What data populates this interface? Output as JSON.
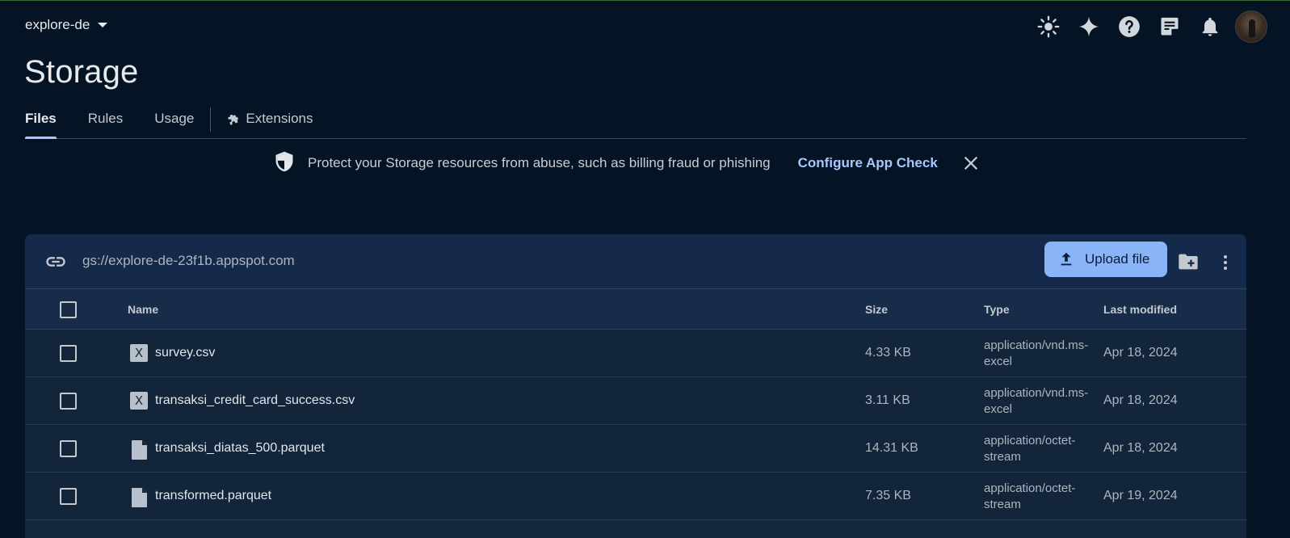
{
  "project": {
    "name": "explore-de"
  },
  "header_icons": [
    "brightness-icon",
    "sparkle-icon",
    "help-icon",
    "notes-icon",
    "bell-icon"
  ],
  "page": {
    "title": "Storage"
  },
  "tabs": [
    {
      "label": "Files",
      "active": true
    },
    {
      "label": "Rules",
      "active": false
    },
    {
      "label": "Usage",
      "active": false
    },
    {
      "label": "Extensions",
      "active": false
    }
  ],
  "banner": {
    "message": "Protect your Storage resources from abuse, such as billing fraud or phishing",
    "link": "Configure App Check"
  },
  "bucket": {
    "path": "gs://explore-de-23f1b.appspot.com",
    "upload_label": "Upload file"
  },
  "table": {
    "columns": {
      "name": "Name",
      "size": "Size",
      "type": "Type",
      "modified": "Last modified"
    },
    "rows": [
      {
        "icon": "excel-file-icon",
        "name": "survey.csv",
        "size": "4.33 KB",
        "type_line1": "application/vnd.ms-",
        "type_line2": "excel",
        "modified": "Apr 18, 2024"
      },
      {
        "icon": "excel-file-icon",
        "name": "transaksi_credit_card_success.csv",
        "size": "3.11 KB",
        "type_line1": "application/vnd.ms-",
        "type_line2": "excel",
        "modified": "Apr 18, 2024"
      },
      {
        "icon": "generic-file-icon",
        "name": "transaksi_diatas_500.parquet",
        "size": "14.31 KB",
        "type_line1": "application/octet-",
        "type_line2": "stream",
        "modified": "Apr 18, 2024"
      },
      {
        "icon": "generic-file-icon",
        "name": "transformed.parquet",
        "size": "7.35 KB",
        "type_line1": "application/octet-",
        "type_line2": "stream",
        "modified": "Apr 19, 2024"
      }
    ]
  },
  "colors": {
    "background": "#041424",
    "accent": "#a8c7fa",
    "button": "#8ab4f8",
    "card": "#13263e"
  }
}
